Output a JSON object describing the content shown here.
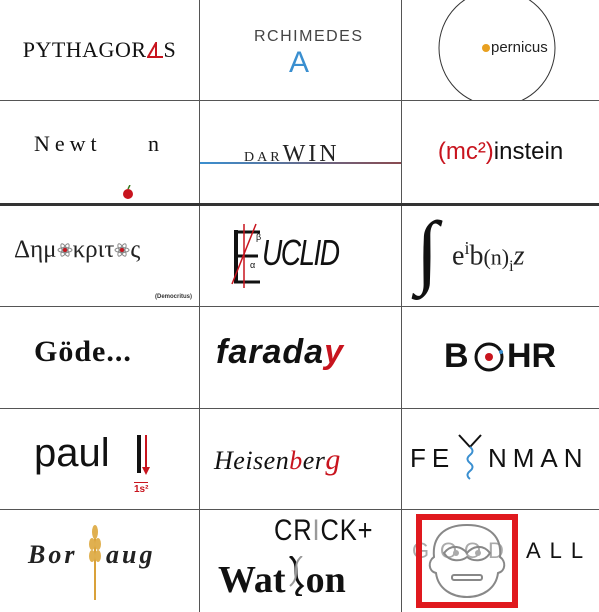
{
  "cells": {
    "pythagoras": {
      "main": "PYTHAGOR",
      "tail": "S"
    },
    "archimedes": {
      "top": "RCHIMEDES",
      "big": "A"
    },
    "copernicus": {
      "text": "pernicus"
    },
    "newton": {
      "left": "Newt",
      "right": "n"
    },
    "darwin": {
      "small": "DAR",
      "big": "WIN"
    },
    "einstein": {
      "red": "(mc²)",
      "rest": "instein"
    },
    "democritus": {
      "text_a": "Δημ",
      "text_b": "κριτ",
      "text_c": "ς",
      "caption": "(Democritus)"
    },
    "euclid": {
      "text": "UCLID",
      "alpha": "α",
      "beta": "β"
    },
    "leibniz": {
      "e": "e",
      "i": "i",
      "b": "b",
      "n": "(n)",
      "i2": "i",
      "z": "z"
    },
    "godel": {
      "text": "Göde..."
    },
    "faraday": {
      "main": "farada",
      "red": "y"
    },
    "bohr": {
      "b": "B",
      "hr": "HR"
    },
    "pauli": {
      "text": "paul",
      "sub": "1s²"
    },
    "heisenberg": {
      "text": "Heisen",
      "mid": "b",
      "end": "er",
      "red": "g"
    },
    "feynman": {
      "left": "FE",
      "right": "NMAN"
    },
    "borlaug": {
      "left": "Bor",
      "right": "aug"
    },
    "crick": {
      "top": "CR",
      "i": "I",
      "rest": "CK+",
      "bottom_a": "Wat",
      "bottom_b": "on"
    },
    "goodall": {
      "left": "G",
      "o1": "O",
      "o2": "O",
      "d": "D",
      "rest": "ALL"
    }
  },
  "colors": {
    "red": "#c8141e",
    "blue": "#3a8fd0",
    "border": "#555555",
    "highlight": "#e0191e"
  }
}
